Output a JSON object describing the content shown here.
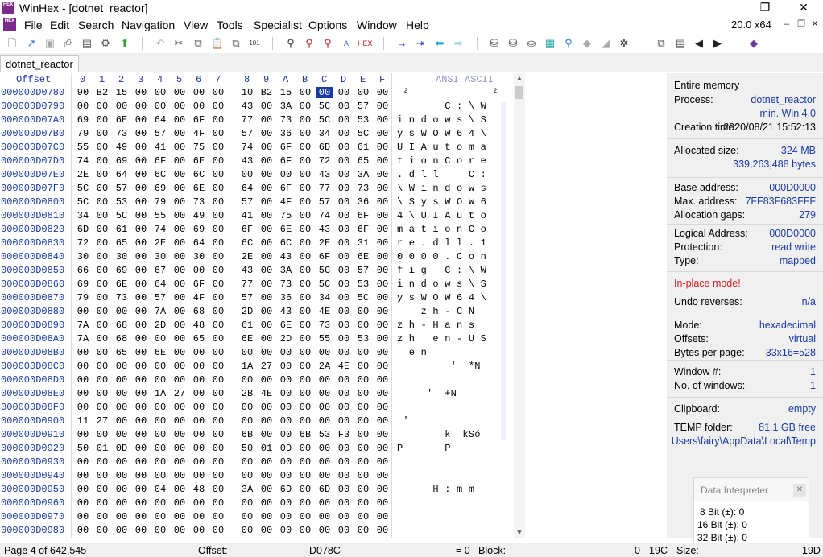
{
  "window": {
    "title": "WinHex - [dotnet_reactor]",
    "logo_text": "HEX",
    "version": "20.0 x64"
  },
  "menu": [
    "File",
    "Edit",
    "Search",
    "Navigation",
    "View",
    "Tools",
    "Specialist",
    "Options",
    "Window",
    "Help"
  ],
  "tab": {
    "label": "dotnet_reactor"
  },
  "hex_header": {
    "offset_label": "Offset",
    "columns": [
      "0",
      "1",
      "2",
      "3",
      "4",
      "5",
      "6",
      "7",
      "8",
      "9",
      "A",
      "B",
      "C",
      "D",
      "E",
      "F"
    ],
    "text_label": "ANSI ASCII"
  },
  "rows": [
    {
      "offset": "000000D0780",
      "bytes": [
        "90",
        "B2",
        "15",
        "00",
        "00",
        "00",
        "00",
        "00",
        "10",
        "B2",
        "15",
        "00",
        "00",
        "00",
        "00",
        "00"
      ],
      "text": " ²              ²"
    },
    {
      "offset": "000000D0790",
      "bytes": [
        "00",
        "00",
        "00",
        "00",
        "00",
        "00",
        "00",
        "00",
        "43",
        "00",
        "3A",
        "00",
        "5C",
        "00",
        "57",
        "00"
      ],
      "text": "        C : \\ W"
    },
    {
      "offset": "000000D07A0",
      "bytes": [
        "69",
        "00",
        "6E",
        "00",
        "64",
        "00",
        "6F",
        "00",
        "77",
        "00",
        "73",
        "00",
        "5C",
        "00",
        "53",
        "00"
      ],
      "text": "i n d o w s \\ S"
    },
    {
      "offset": "000000D07B0",
      "bytes": [
        "79",
        "00",
        "73",
        "00",
        "57",
        "00",
        "4F",
        "00",
        "57",
        "00",
        "36",
        "00",
        "34",
        "00",
        "5C",
        "00"
      ],
      "text": "y s W O W 6 4 \\"
    },
    {
      "offset": "000000D07C0",
      "bytes": [
        "55",
        "00",
        "49",
        "00",
        "41",
        "00",
        "75",
        "00",
        "74",
        "00",
        "6F",
        "00",
        "6D",
        "00",
        "61",
        "00"
      ],
      "text": "U I A u t o m a"
    },
    {
      "offset": "000000D07D0",
      "bytes": [
        "74",
        "00",
        "69",
        "00",
        "6F",
        "00",
        "6E",
        "00",
        "43",
        "00",
        "6F",
        "00",
        "72",
        "00",
        "65",
        "00"
      ],
      "text": "t i o n C o r e"
    },
    {
      "offset": "000000D07E0",
      "bytes": [
        "2E",
        "00",
        "64",
        "00",
        "6C",
        "00",
        "6C",
        "00",
        "00",
        "00",
        "00",
        "00",
        "43",
        "00",
        "3A",
        "00"
      ],
      "text": ". d l l     C :"
    },
    {
      "offset": "000000D07F0",
      "bytes": [
        "5C",
        "00",
        "57",
        "00",
        "69",
        "00",
        "6E",
        "00",
        "64",
        "00",
        "6F",
        "00",
        "77",
        "00",
        "73",
        "00"
      ],
      "text": "\\ W i n d o w s"
    },
    {
      "offset": "000000D0800",
      "bytes": [
        "5C",
        "00",
        "53",
        "00",
        "79",
        "00",
        "73",
        "00",
        "57",
        "00",
        "4F",
        "00",
        "57",
        "00",
        "36",
        "00"
      ],
      "text": "\\ S y s W O W 6"
    },
    {
      "offset": "000000D0810",
      "bytes": [
        "34",
        "00",
        "5C",
        "00",
        "55",
        "00",
        "49",
        "00",
        "41",
        "00",
        "75",
        "00",
        "74",
        "00",
        "6F",
        "00"
      ],
      "text": "4 \\ U I A u t o"
    },
    {
      "offset": "000000D0820",
      "bytes": [
        "6D",
        "00",
        "61",
        "00",
        "74",
        "00",
        "69",
        "00",
        "6F",
        "00",
        "6E",
        "00",
        "43",
        "00",
        "6F",
        "00"
      ],
      "text": "m a t i o n C o"
    },
    {
      "offset": "000000D0830",
      "bytes": [
        "72",
        "00",
        "65",
        "00",
        "2E",
        "00",
        "64",
        "00",
        "6C",
        "00",
        "6C",
        "00",
        "2E",
        "00",
        "31",
        "00"
      ],
      "text": "r e . d l l . 1"
    },
    {
      "offset": "000000D0840",
      "bytes": [
        "30",
        "00",
        "30",
        "00",
        "30",
        "00",
        "30",
        "00",
        "2E",
        "00",
        "43",
        "00",
        "6F",
        "00",
        "6E",
        "00"
      ],
      "text": "0 0 0 0 . C o n"
    },
    {
      "offset": "000000D0850",
      "bytes": [
        "66",
        "00",
        "69",
        "00",
        "67",
        "00",
        "00",
        "00",
        "43",
        "00",
        "3A",
        "00",
        "5C",
        "00",
        "57",
        "00"
      ],
      "text": "f i g   C : \\ W"
    },
    {
      "offset": "000000D0860",
      "bytes": [
        "69",
        "00",
        "6E",
        "00",
        "64",
        "00",
        "6F",
        "00",
        "77",
        "00",
        "73",
        "00",
        "5C",
        "00",
        "53",
        "00"
      ],
      "text": "i n d o w s \\ S"
    },
    {
      "offset": "000000D0870",
      "bytes": [
        "79",
        "00",
        "73",
        "00",
        "57",
        "00",
        "4F",
        "00",
        "57",
        "00",
        "36",
        "00",
        "34",
        "00",
        "5C",
        "00"
      ],
      "text": "y s W O W 6 4 \\"
    },
    {
      "offset": "000000D0880",
      "bytes": [
        "00",
        "00",
        "00",
        "00",
        "7A",
        "00",
        "68",
        "00",
        "2D",
        "00",
        "43",
        "00",
        "4E",
        "00",
        "00",
        "00"
      ],
      "text": "    z h - C N"
    },
    {
      "offset": "000000D0890",
      "bytes": [
        "7A",
        "00",
        "68",
        "00",
        "2D",
        "00",
        "48",
        "00",
        "61",
        "00",
        "6E",
        "00",
        "73",
        "00",
        "00",
        "00"
      ],
      "text": "z h - H a n s"
    },
    {
      "offset": "000000D08A0",
      "bytes": [
        "7A",
        "00",
        "68",
        "00",
        "00",
        "00",
        "65",
        "00",
        "6E",
        "00",
        "2D",
        "00",
        "55",
        "00",
        "53",
        "00"
      ],
      "text": "z h   e n - U S"
    },
    {
      "offset": "000000D08B0",
      "bytes": [
        "00",
        "00",
        "65",
        "00",
        "6E",
        "00",
        "00",
        "00",
        "00",
        "00",
        "00",
        "00",
        "00",
        "00",
        "00",
        "00"
      ],
      "text": "  e n"
    },
    {
      "offset": "000000D08C0",
      "bytes": [
        "00",
        "00",
        "00",
        "00",
        "00",
        "00",
        "00",
        "00",
        "1A",
        "27",
        "00",
        "00",
        "2A",
        "4E",
        "00",
        "00"
      ],
      "text": "         '  *N"
    },
    {
      "offset": "000000D08D0",
      "bytes": [
        "00",
        "00",
        "00",
        "00",
        "00",
        "00",
        "00",
        "00",
        "00",
        "00",
        "00",
        "00",
        "00",
        "00",
        "00",
        "00"
      ],
      "text": ""
    },
    {
      "offset": "000000D08E0",
      "bytes": [
        "00",
        "00",
        "00",
        "00",
        "1A",
        "27",
        "00",
        "00",
        "2B",
        "4E",
        "00",
        "00",
        "00",
        "00",
        "00",
        "00"
      ],
      "text": "     '  +N"
    },
    {
      "offset": "000000D08F0",
      "bytes": [
        "00",
        "00",
        "00",
        "00",
        "00",
        "00",
        "00",
        "00",
        "00",
        "00",
        "00",
        "00",
        "00",
        "00",
        "00",
        "00"
      ],
      "text": ""
    },
    {
      "offset": "000000D0900",
      "bytes": [
        "11",
        "27",
        "00",
        "00",
        "00",
        "00",
        "00",
        "00",
        "00",
        "00",
        "00",
        "00",
        "00",
        "00",
        "00",
        "00"
      ],
      "text": " '"
    },
    {
      "offset": "000000D0910",
      "bytes": [
        "00",
        "00",
        "00",
        "00",
        "00",
        "00",
        "00",
        "00",
        "6B",
        "00",
        "00",
        "6B",
        "53",
        "F3",
        "00",
        "00"
      ],
      "text": "        k  kSó"
    },
    {
      "offset": "000000D0920",
      "bytes": [
        "50",
        "01",
        "0D",
        "00",
        "00",
        "00",
        "00",
        "00",
        "50",
        "01",
        "0D",
        "00",
        "00",
        "00",
        "00",
        "00"
      ],
      "text": "P       P"
    },
    {
      "offset": "000000D0930",
      "bytes": [
        "00",
        "00",
        "00",
        "00",
        "00",
        "00",
        "00",
        "00",
        "00",
        "00",
        "00",
        "00",
        "00",
        "00",
        "00",
        "00"
      ],
      "text": ""
    },
    {
      "offset": "000000D0940",
      "bytes": [
        "00",
        "00",
        "00",
        "00",
        "00",
        "00",
        "00",
        "00",
        "00",
        "00",
        "00",
        "00",
        "00",
        "00",
        "00",
        "00"
      ],
      "text": ""
    },
    {
      "offset": "000000D0950",
      "bytes": [
        "00",
        "00",
        "00",
        "00",
        "04",
        "00",
        "48",
        "00",
        "3A",
        "00",
        "6D",
        "00",
        "6D",
        "00",
        "00",
        "00"
      ],
      "text": "      H : m m"
    },
    {
      "offset": "000000D0960",
      "bytes": [
        "00",
        "00",
        "00",
        "00",
        "00",
        "00",
        "00",
        "00",
        "00",
        "00",
        "00",
        "00",
        "00",
        "00",
        "00",
        "00"
      ],
      "text": ""
    },
    {
      "offset": "000000D0970",
      "bytes": [
        "00",
        "00",
        "00",
        "00",
        "00",
        "00",
        "00",
        "00",
        "00",
        "00",
        "00",
        "00",
        "00",
        "00",
        "00",
        "00"
      ],
      "text": ""
    },
    {
      "offset": "000000D0980",
      "bytes": [
        "00",
        "00",
        "00",
        "00",
        "00",
        "00",
        "00",
        "00",
        "00",
        "00",
        "00",
        "00",
        "00",
        "00",
        "00",
        "00"
      ],
      "text": ""
    }
  ],
  "info": {
    "entire_memory": "Entire memory",
    "process_label": "Process:",
    "process_value": "dotnet_reactor",
    "process_min": "min. Win 4.0",
    "creation_label": "Creation time:",
    "creation_value": "2020/08/21  15:52:13",
    "alloc_size_label": "Allocated size:",
    "alloc_size_value": "324 MB",
    "alloc_bytes": "339,263,488 bytes",
    "base_label": "Base address:",
    "base_value": "000D0000",
    "max_label": "Max. address:",
    "max_value": "7FF83F683FFF",
    "gaps_label": "Allocation gaps:",
    "gaps_value": "279",
    "logical_label": "Logical Address:",
    "logical_value": "000D0000",
    "protection_label": "Protection:",
    "protection_value": "read write",
    "type_label": "Type:",
    "type_value": "mapped",
    "inplace": "In-place mode!",
    "undo_label": "Undo reverses:",
    "undo_value": "n/a",
    "mode_label": "Mode:",
    "mode_value": "hexadecimal",
    "offsets_label": "Offsets:",
    "offsets_value": "virtual",
    "bpp_label": "Bytes per page:",
    "bpp_value": "33x16=528",
    "window_label": "Window #:",
    "window_value": "1",
    "nwin_label": "No. of windows:",
    "nwin_value": "1",
    "clip_label": "Clipboard:",
    "clip_value": "empty",
    "temp_label": "TEMP folder:",
    "temp_value": "81.1 GB free",
    "temp_path": "Users\\fairy\\AppData\\Local\\Temp"
  },
  "interpreter": {
    "title": "Data Interpreter",
    "line8": "8 Bit (±): 0",
    "line16": "16 Bit (±): 0",
    "line32": "32 Bit (±): 0"
  },
  "status": {
    "page": "Page 4 of 642,545",
    "offset_label": "Offset:",
    "offset_value": "D078C",
    "eq": "= 0",
    "block_label": "Block:",
    "block_value": "0 - 19C",
    "size_label": "Size:",
    "size_value": "19D"
  }
}
